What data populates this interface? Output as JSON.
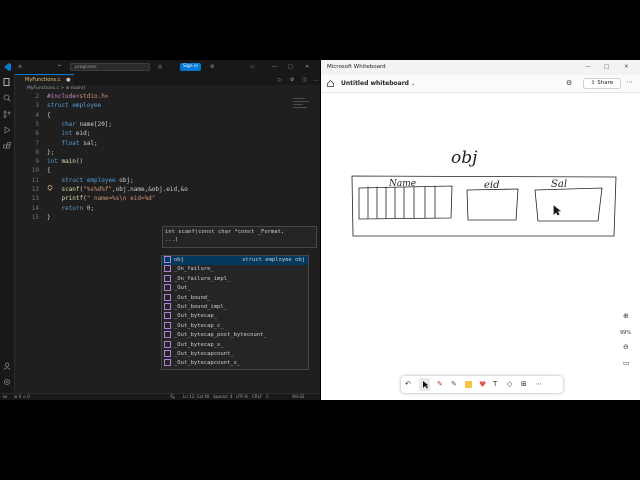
{
  "vscode": {
    "search_text": "programs",
    "signin_label": "Sign in",
    "tab_label": "MyFunctions.c",
    "breadcrumb": "MyFunctions.c > ⊘ main()",
    "code_lines": [
      {
        "n": "2",
        "tokens": [
          {
            "c": "pp",
            "t": "#include"
          },
          {
            "c": "hd",
            "t": "<stdio.h>"
          }
        ]
      },
      {
        "n": "3",
        "tokens": [
          {
            "c": "kw",
            "t": "struct"
          },
          {
            "c": "",
            "t": " "
          },
          {
            "c": "ty",
            "t": "employee"
          }
        ]
      },
      {
        "n": "4",
        "tokens": [
          {
            "c": "",
            "t": "{"
          }
        ]
      },
      {
        "n": "5",
        "tokens": [
          {
            "c": "",
            "t": "    "
          },
          {
            "c": "kw",
            "t": "char"
          },
          {
            "c": "",
            "t": " name[20];"
          }
        ]
      },
      {
        "n": "6",
        "tokens": [
          {
            "c": "",
            "t": "    "
          },
          {
            "c": "kw",
            "t": "int"
          },
          {
            "c": "",
            "t": " eid;"
          }
        ]
      },
      {
        "n": "7",
        "tokens": [
          {
            "c": "",
            "t": "    "
          },
          {
            "c": "kw",
            "t": "float"
          },
          {
            "c": "",
            "t": " sal;"
          }
        ]
      },
      {
        "n": "8",
        "tokens": [
          {
            "c": "",
            "t": "};"
          }
        ]
      },
      {
        "n": "9",
        "tokens": [
          {
            "c": "kw",
            "t": "int"
          },
          {
            "c": "",
            "t": " "
          },
          {
            "c": "fn",
            "t": "main"
          },
          {
            "c": "",
            "t": "()"
          }
        ]
      },
      {
        "n": "10",
        "tokens": [
          {
            "c": "",
            "t": "{"
          }
        ]
      },
      {
        "n": "11",
        "tokens": [
          {
            "c": "",
            "t": "    "
          },
          {
            "c": "kw",
            "t": "struct"
          },
          {
            "c": "",
            "t": " "
          },
          {
            "c": "ty",
            "t": "employee"
          },
          {
            "c": "",
            "t": " obj;"
          }
        ]
      },
      {
        "n": "12",
        "tokens": [
          {
            "c": "",
            "t": "    "
          },
          {
            "c": "fn",
            "t": "scanf"
          },
          {
            "c": "",
            "t": "("
          },
          {
            "c": "st",
            "t": "\"%s%d%f\""
          },
          {
            "c": "",
            "t": ",obj.name,&obj.eid,&o"
          }
        ]
      },
      {
        "n": "13",
        "tokens": [
          {
            "c": "",
            "t": "    "
          },
          {
            "c": "fn",
            "t": "printf"
          },
          {
            "c": "",
            "t": "("
          },
          {
            "c": "st",
            "t": "\" name=%s\\n eid=%d\""
          }
        ]
      },
      {
        "n": "14",
        "tokens": [
          {
            "c": "",
            "t": "    "
          },
          {
            "c": "kw",
            "t": "return"
          },
          {
            "c": "",
            "t": " "
          },
          {
            "c": "nu",
            "t": "0"
          },
          {
            "c": "",
            "t": ";"
          }
        ]
      },
      {
        "n": "15",
        "tokens": [
          {
            "c": "",
            "t": "}"
          }
        ]
      }
    ],
    "signature_help": [
      "int scanf(const char *const _Format,",
      "...)"
    ],
    "suggestions": [
      {
        "label": "obj",
        "detail": "struct employee obj",
        "selected": true
      },
      {
        "label": "_On_failure_",
        "detail": ""
      },
      {
        "label": "_On_failure_impl_",
        "detail": ""
      },
      {
        "label": "_Out_",
        "detail": ""
      },
      {
        "label": "_Out_bound_",
        "detail": ""
      },
      {
        "label": "_Out_bound_impl_",
        "detail": ""
      },
      {
        "label": "_Out_bytecap_",
        "detail": ""
      },
      {
        "label": "_Out_bytecap_c_",
        "detail": ""
      },
      {
        "label": "_Out_bytecap_post_bytecount_",
        "detail": ""
      },
      {
        "label": "_Out_bytecap_x_",
        "detail": ""
      },
      {
        "label": "_Out_bytecapcount_",
        "detail": ""
      },
      {
        "label": "_Out_bytecapcount_x_",
        "detail": ""
      }
    ],
    "status": {
      "errors": "⊗ 0 ⚠ 0",
      "position": "Ln 12, Col 40",
      "spaces": "Spaces: 4",
      "encoding": "UTF-8",
      "eol": "CRLF",
      "language": "C",
      "platform": "Win32"
    }
  },
  "whiteboard": {
    "app_title": "Microsoft Whiteboard",
    "board_name": "Untitled whiteboard",
    "share_label": "Share",
    "zoom": "99%",
    "handwriting": {
      "obj": "obj",
      "name": "Name",
      "eid": "eid",
      "sal": "Sal"
    }
  },
  "colors": {
    "accent": "#0078d4",
    "editor_bg": "#1f1f1f",
    "whiteboard_bg": "#ffffff"
  }
}
